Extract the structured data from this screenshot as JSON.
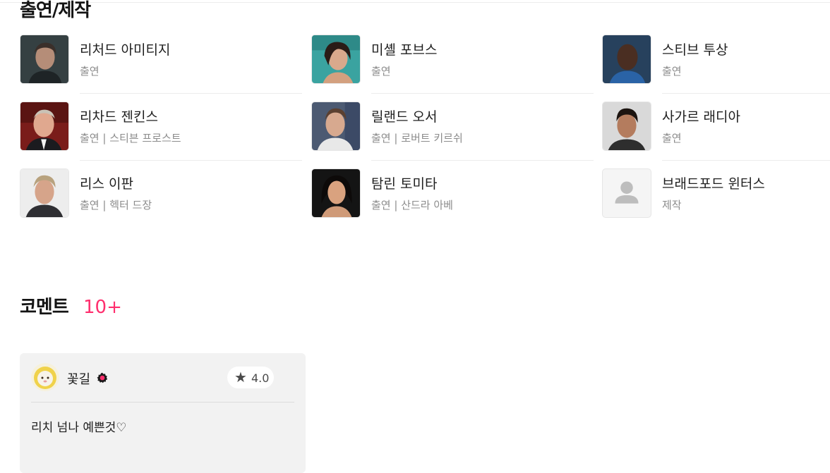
{
  "section_title": "출연/제작",
  "cast": [
    {
      "name": "리처드 아미티지",
      "role": "출연"
    },
    {
      "name": "미셸 포브스",
      "role": "출연"
    },
    {
      "name": "스티브 투상",
      "role": "출연"
    },
    {
      "name": "리차드 젠킨스",
      "role": "출연 | 스티븐 프로스트"
    },
    {
      "name": "릴랜드 오서",
      "role": "출연 | 로버트 키르쉬"
    },
    {
      "name": "사가르 래디아",
      "role": "출연"
    },
    {
      "name": "리스 이판",
      "role": "출연 | 헥터 드장"
    },
    {
      "name": "탐린 토미타",
      "role": "출연 | 산드라 아베"
    },
    {
      "name": "브래드포드 윈터스",
      "role": "제작"
    }
  ],
  "comments": {
    "heading": "코멘트",
    "count": "10+",
    "items": [
      {
        "user": "꽃길",
        "rating": "4.0",
        "rating_icon": "star-icon",
        "text": "리치 넘나 예쁜것♡"
      }
    ]
  },
  "colors": {
    "accent": "#ff2f6e",
    "card_bg": "#f2f2f2",
    "meta_text": "#8c8c8c"
  }
}
